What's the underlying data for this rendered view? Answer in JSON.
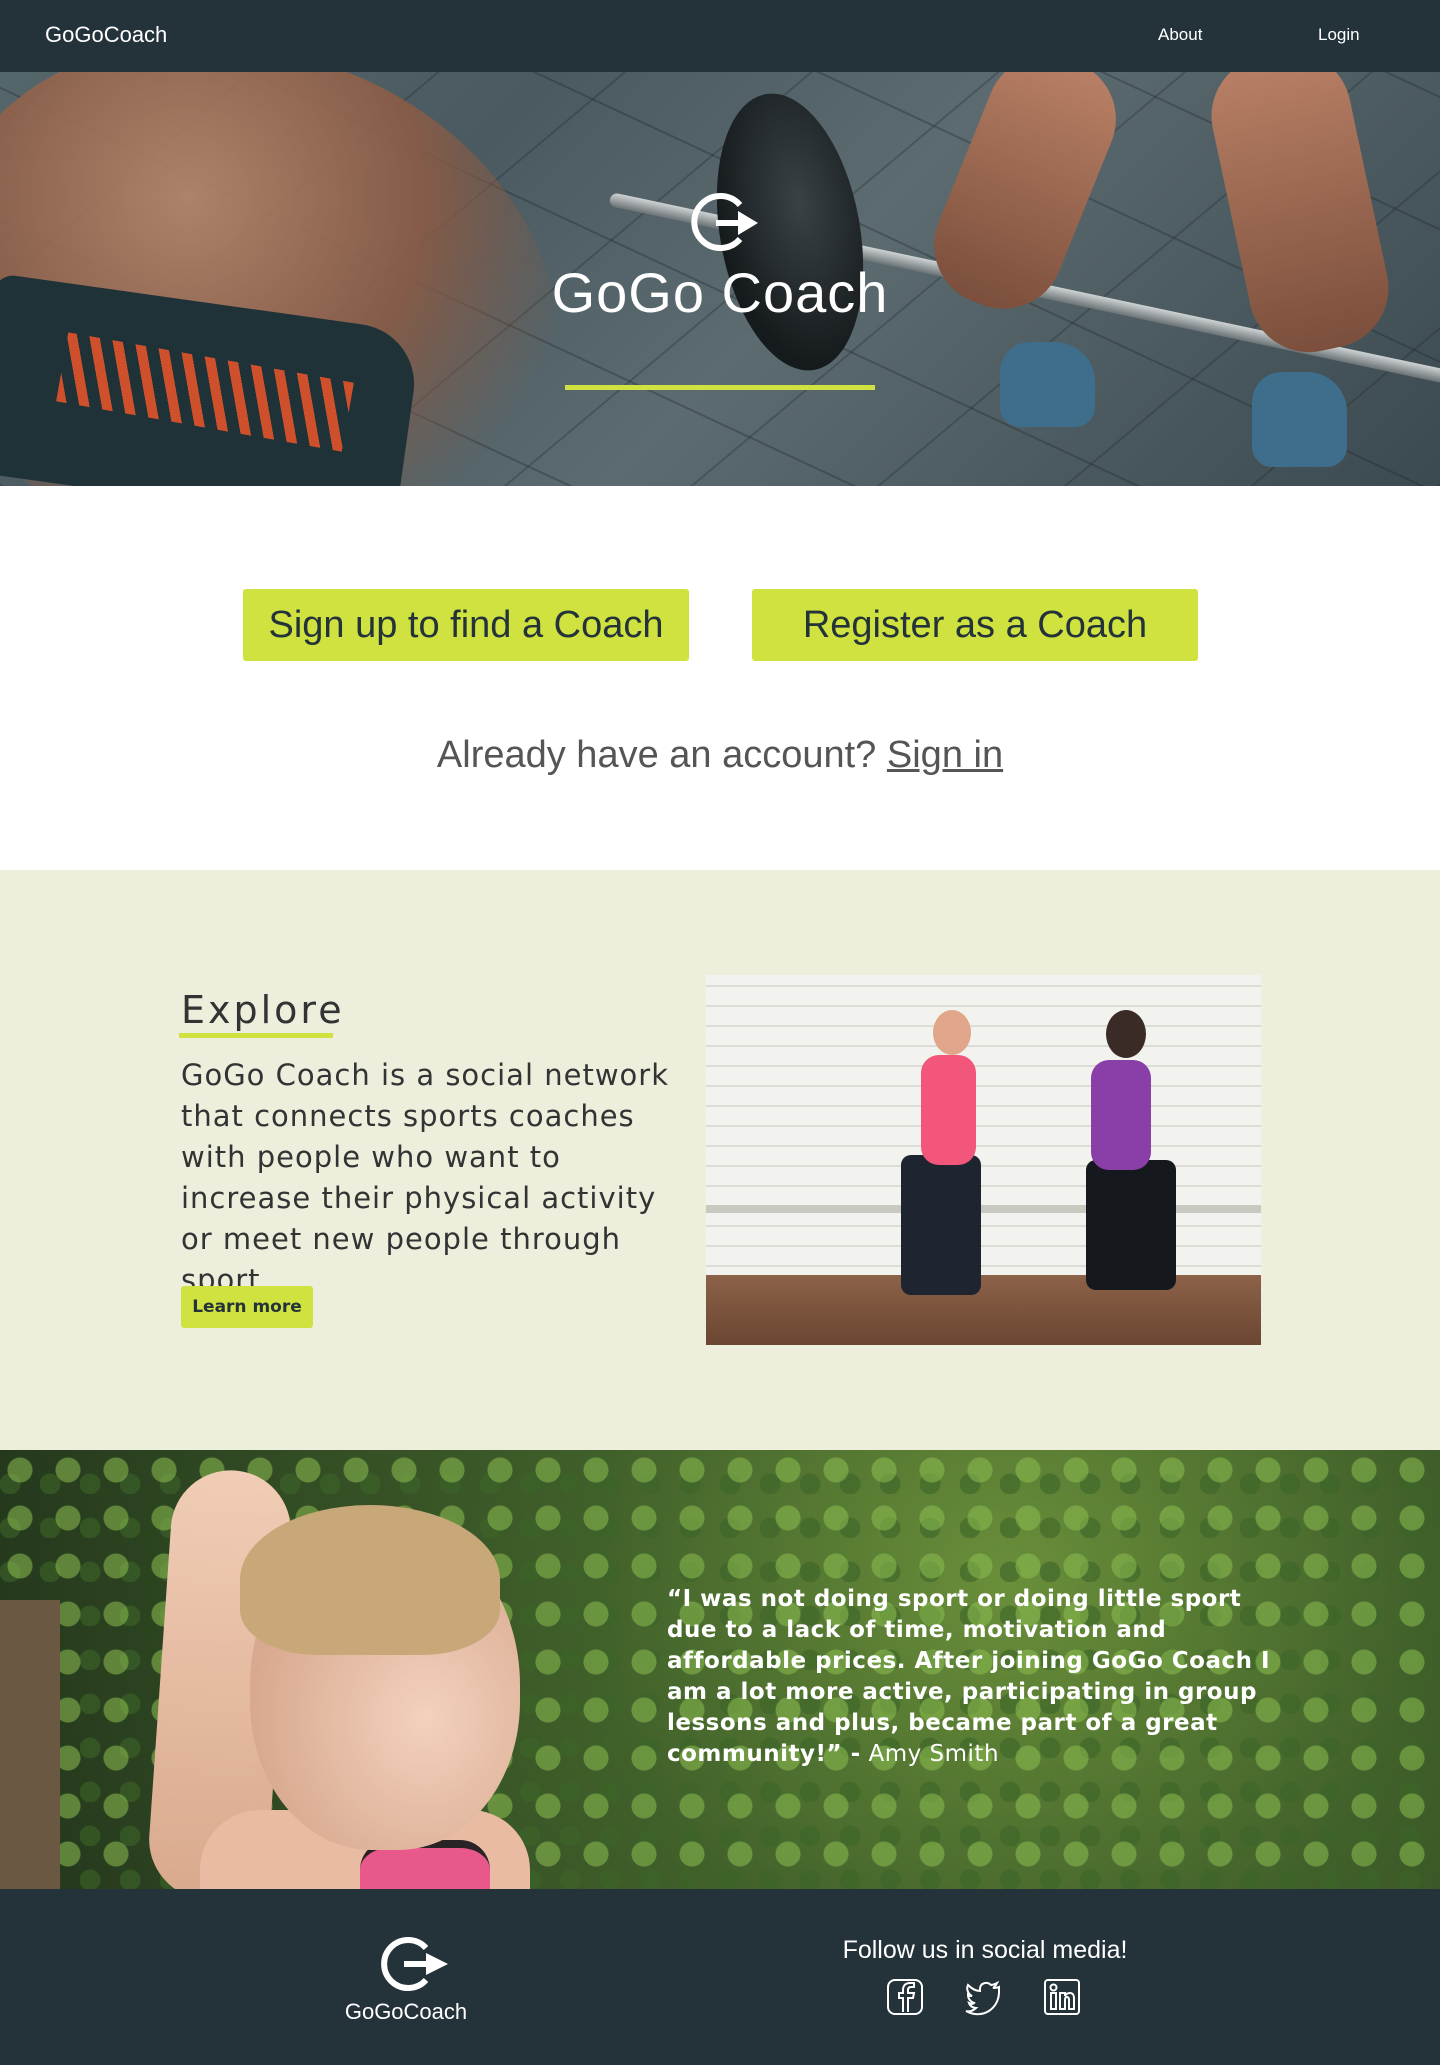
{
  "nav": {
    "brand": "GoGoCoach",
    "about": "About",
    "login": "Login"
  },
  "hero": {
    "title": "GoGo Coach"
  },
  "cta": {
    "signup_label": "Sign up to find a Coach",
    "register_label": "Register as a Coach",
    "account_prompt": "Already have an account?",
    "signin_label": "Sign in"
  },
  "explore": {
    "heading": "Explore",
    "description": "GoGo Coach is a social network that connects sports coaches with people who want to increase their physical activity or meet new people through sport.",
    "learn_more_label": "Learn more"
  },
  "testimonial": {
    "quote": "“I was not doing sport or doing little sport due to a lack of time, motivation and affordable prices. After joining GoGo Coach I am a lot more active, participating in group lessons and plus, became part of a great community!” -",
    "author": "Amy Smith"
  },
  "footer": {
    "brand": "GoGoCoach",
    "follow_text": "Follow us in social media!",
    "social": [
      "facebook-icon",
      "twitter-icon",
      "linkedin-icon"
    ]
  },
  "colors": {
    "nav_bg": "#24333a",
    "accent": "#cfe23f",
    "explore_bg": "#edeedc"
  }
}
